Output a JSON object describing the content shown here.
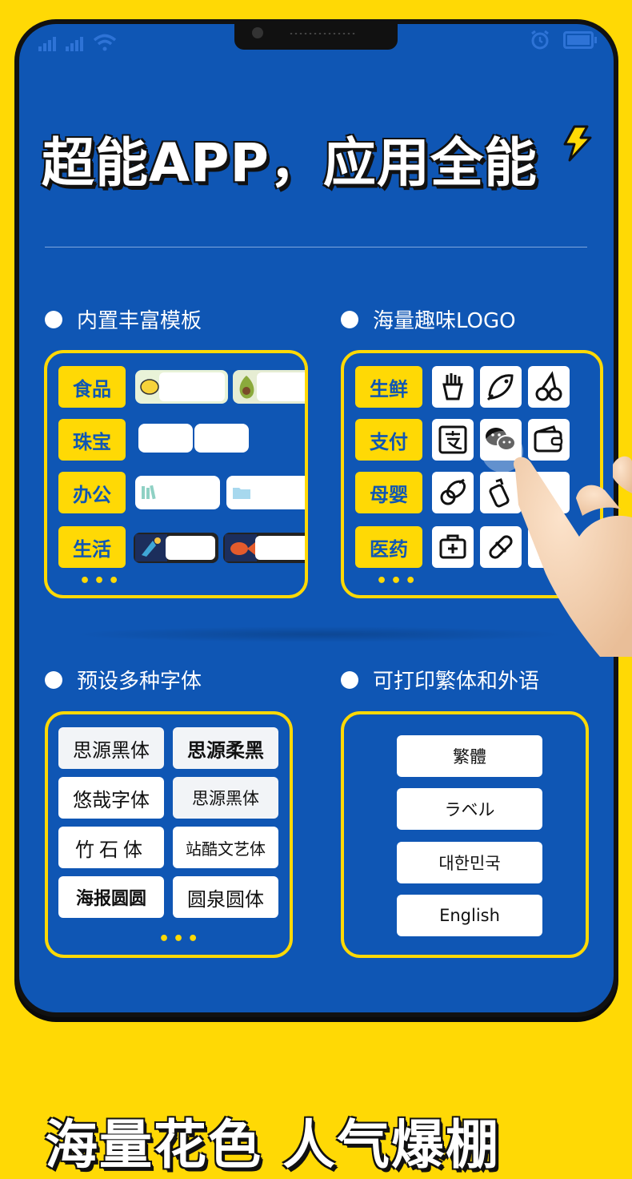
{
  "headline": "超能APP，应用全能",
  "bottom_title": "海量花色 人气爆棚",
  "colors": {
    "background": "#FFD905",
    "screen": "#0F56B4",
    "accent": "#FFD905",
    "text": "#FFFFFF"
  },
  "sections": {
    "templates": {
      "title": "内置丰富模板",
      "categories": [
        "食品",
        "珠宝",
        "办公",
        "生活"
      ],
      "more": "•••"
    },
    "logos": {
      "title": "海量趣味LOGO",
      "categories": [
        "生鲜",
        "支付",
        "母婴",
        "医药"
      ],
      "icons": [
        "fries-icon",
        "fish-icon",
        "cherry-icon",
        "alipay-icon",
        "wechat-icon",
        "wallet-icon",
        "pacifier-icon",
        "baby-bottle-icon",
        "stroller-icon",
        "medical-kit-icon",
        "pill-icon",
        "medicine-bottle-icon"
      ],
      "more": "•••"
    },
    "fonts": {
      "title": "预设多种字体",
      "items": [
        "思源黑体",
        "思源柔黑",
        "悠哉字体",
        "思源黑体",
        "竹石体",
        "站酷文艺体",
        "海报圆圆",
        "圆泉圆体"
      ],
      "more": "•••"
    },
    "languages": {
      "title": "可打印繁体和外语",
      "items": [
        "繁體",
        "ラベル",
        "대한민국",
        "English"
      ]
    }
  }
}
